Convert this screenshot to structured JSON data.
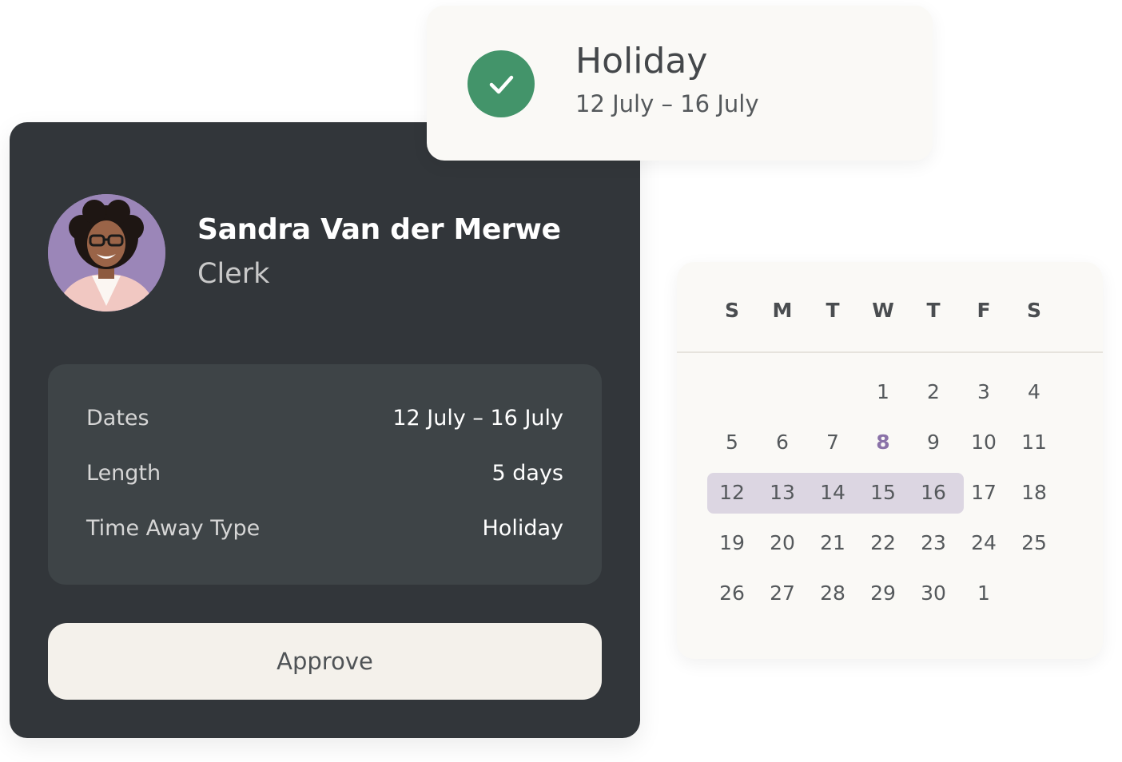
{
  "request": {
    "employee_name": "Sandra Van der Merwe",
    "employee_role": "Clerk",
    "details": [
      {
        "label": "Dates",
        "value": "12 July – 16 July"
      },
      {
        "label": "Length",
        "value": "5 days"
      },
      {
        "label": "Time Away Type",
        "value": "Holiday"
      }
    ],
    "approve_label": "Approve"
  },
  "notification": {
    "title": "Holiday",
    "dates": "12 July – 16 July",
    "icon": "check-icon",
    "status_color": "#43946a"
  },
  "calendar": {
    "weekdays": [
      "S",
      "M",
      "T",
      "W",
      "T",
      "F",
      "S"
    ],
    "weeks": [
      [
        "",
        "",
        "",
        "1",
        "2",
        "3",
        "4"
      ],
      [
        "5",
        "6",
        "7",
        "8",
        "9",
        "10",
        "11"
      ],
      [
        "12",
        "13",
        "14",
        "15",
        "16",
        "17",
        "18"
      ],
      [
        "19",
        "20",
        "21",
        "22",
        "23",
        "24",
        "25"
      ],
      [
        "26",
        "27",
        "28",
        "29",
        "30",
        "1",
        ""
      ]
    ],
    "today": "8",
    "selected_range": [
      "12",
      "13",
      "14",
      "15",
      "16"
    ],
    "today_color": "#8a72a8",
    "range_color": "#dcd6e2"
  },
  "colors": {
    "card_dark": "#32363a",
    "panel_dark": "#3e4447",
    "button_light": "#f4f1eb"
  }
}
